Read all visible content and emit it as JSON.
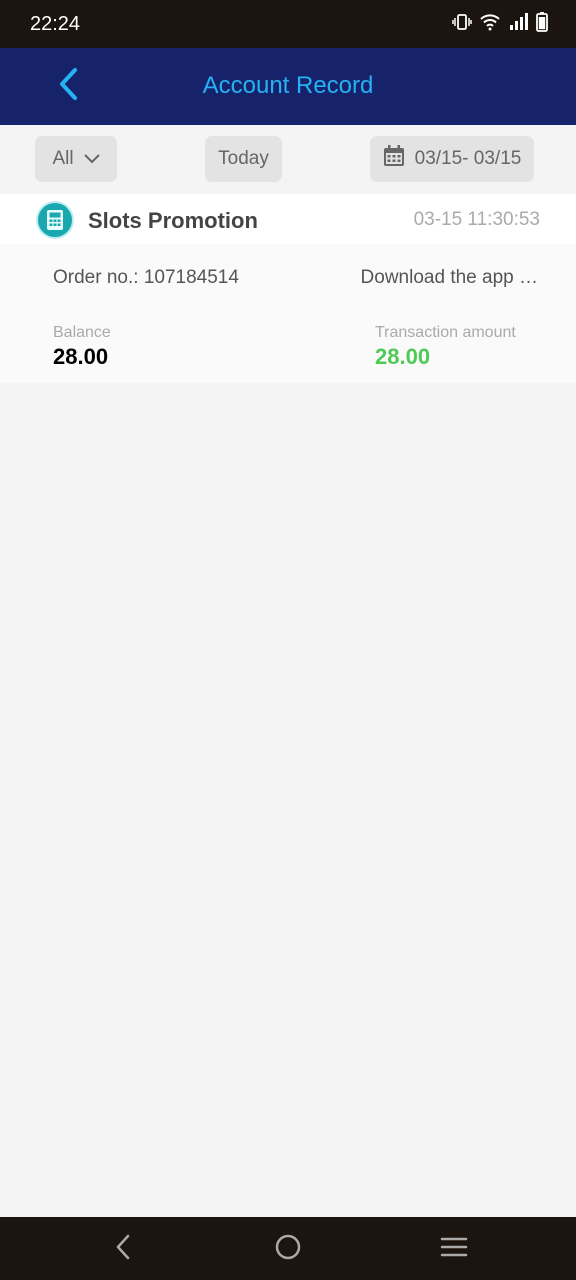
{
  "status_bar": {
    "time": "22:24",
    "icons": [
      "vibrate-icon",
      "wifi-icon",
      "signal-icon",
      "battery-icon"
    ]
  },
  "header": {
    "title": "Account Record",
    "back_icon": "chevron-left-icon"
  },
  "filters": {
    "type_selected": "All",
    "today_label": "Today",
    "date_range": "03/15- 03/15",
    "calendar_icon": "calendar-icon"
  },
  "record": {
    "icon": "receipt-icon",
    "title": "Slots Promotion",
    "time": "03-15 11:30:53",
    "order_label": "Order no.: ",
    "order_no": "107184514",
    "description": "Download the app …",
    "balance_label": "Balance",
    "balance_value": "28.00",
    "amount_label": "Transaction amount",
    "amount_value": "28.00"
  },
  "colors": {
    "header_bg": "#16236a",
    "accent": "#27b1f5",
    "positive_amount": "#4ecb55",
    "system_bar_bg": "#1c140e"
  },
  "nav_bar": {
    "icons": [
      "back-icon",
      "home-icon",
      "menu-icon"
    ]
  }
}
